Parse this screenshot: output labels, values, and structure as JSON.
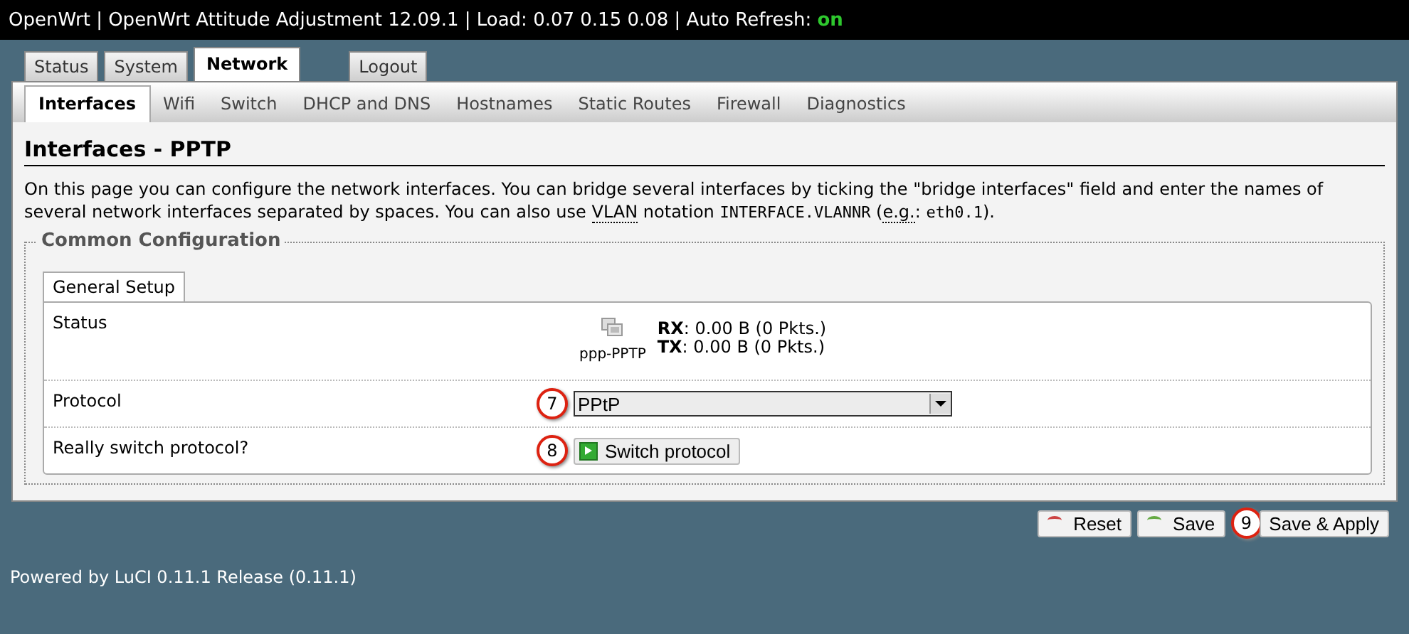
{
  "header": {
    "title": "OpenWrt | OpenWrt Attitude Adjustment 12.09.1 | Load: 0.07 0.15 0.08 | Auto Refresh: ",
    "refresh": "on"
  },
  "tabs": [
    {
      "label": "Status",
      "selected": false
    },
    {
      "label": "System",
      "selected": false
    },
    {
      "label": "Network",
      "selected": true
    },
    {
      "label": "Logout",
      "selected": false,
      "kind": "separate"
    }
  ],
  "subtabs": [
    {
      "label": "Interfaces",
      "selected": true
    },
    {
      "label": "Wifi",
      "selected": false
    },
    {
      "label": "Switch",
      "selected": false
    },
    {
      "label": "DHCP and DNS",
      "selected": false
    },
    {
      "label": "Hostnames",
      "selected": false
    },
    {
      "label": "Static Routes",
      "selected": false
    },
    {
      "label": "Firewall",
      "selected": false
    },
    {
      "label": "Diagnostics",
      "selected": false
    }
  ],
  "page_title": "Interfaces - PPTP",
  "description": [
    {
      "kind": "text",
      "text": "On this page you can configure the network interfaces. You can bridge several interfaces by ticking the \"bridge interfaces\" field and enter the names of several network interfaces separated by spaces. You can also use "
    },
    {
      "kind": "abbr",
      "text": "VLAN"
    },
    {
      "kind": "text",
      "text": " notation "
    },
    {
      "kind": "code",
      "text": "INTERFACE.VLANNR"
    },
    {
      "kind": "text",
      "text": " ("
    },
    {
      "kind": "abbr",
      "text": "e.g."
    },
    {
      "kind": "text",
      "text": ": "
    },
    {
      "kind": "code",
      "text": "eth0.1"
    },
    {
      "kind": "text",
      "text": ")."
    }
  ],
  "section": {
    "legend": "Common Configuration",
    "tab": "General Setup",
    "status": {
      "label": "Status",
      "device": "ppp-PPTP",
      "rx_label": "RX",
      "rx": ": 0.00 B (0 Pkts.)",
      "tx_label": "TX",
      "tx": ": 0.00 B (0 Pkts.)"
    },
    "protocol": {
      "label": "Protocol",
      "value": "PPtP",
      "callout": "7"
    },
    "switch": {
      "label": "Really switch protocol?",
      "button": "Switch protocol",
      "callout": "8"
    }
  },
  "actions": [
    {
      "label": "Reset",
      "kind": "reset"
    },
    {
      "label": "Save",
      "kind": "save"
    },
    {
      "label": "Save & Apply",
      "kind": "apply",
      "callout": "9"
    }
  ],
  "footer": "Powered by LuCI 0.11.1 Release (0.11.1)"
}
